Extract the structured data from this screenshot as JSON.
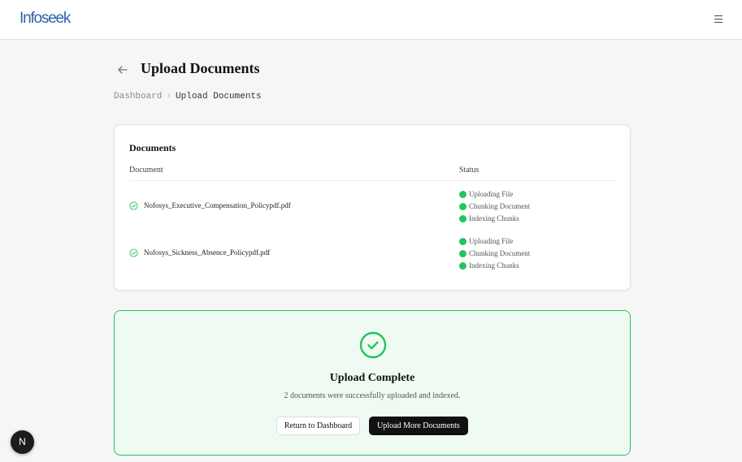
{
  "header": {
    "logo_text": "Infoseek",
    "menu_icon": "hamburger-menu-icon"
  },
  "page": {
    "title": "Upload Documents",
    "back_icon": "arrow-left-icon"
  },
  "breadcrumb": {
    "items": [
      "Dashboard",
      "Upload Documents"
    ],
    "separator": ">"
  },
  "documents_card": {
    "title": "Documents",
    "columns": [
      "Document",
      "Status"
    ],
    "rows": [
      {
        "name": "Nofosys_Executive_Compensation_Policypdf.pdf",
        "statuses": [
          "Uploading File",
          "Chunking Document",
          "Indexing Chunks"
        ]
      },
      {
        "name": "Nofosys_Sickness_Absence_Policypdf.pdf",
        "statuses": [
          "Uploading File",
          "Chunking Document",
          "Indexing Chunks"
        ]
      }
    ]
  },
  "complete": {
    "title": "Upload Complete",
    "message": "2 documents were successfully uploaded and indexed.",
    "return_label": "Return to Dashboard",
    "upload_more_label": "Upload More Documents"
  },
  "badge": {
    "label": "N"
  },
  "colors": {
    "success": "#22c55e",
    "success_bg": "#effbf2",
    "logo": "#2f62a8",
    "primary_button": "#111111"
  }
}
